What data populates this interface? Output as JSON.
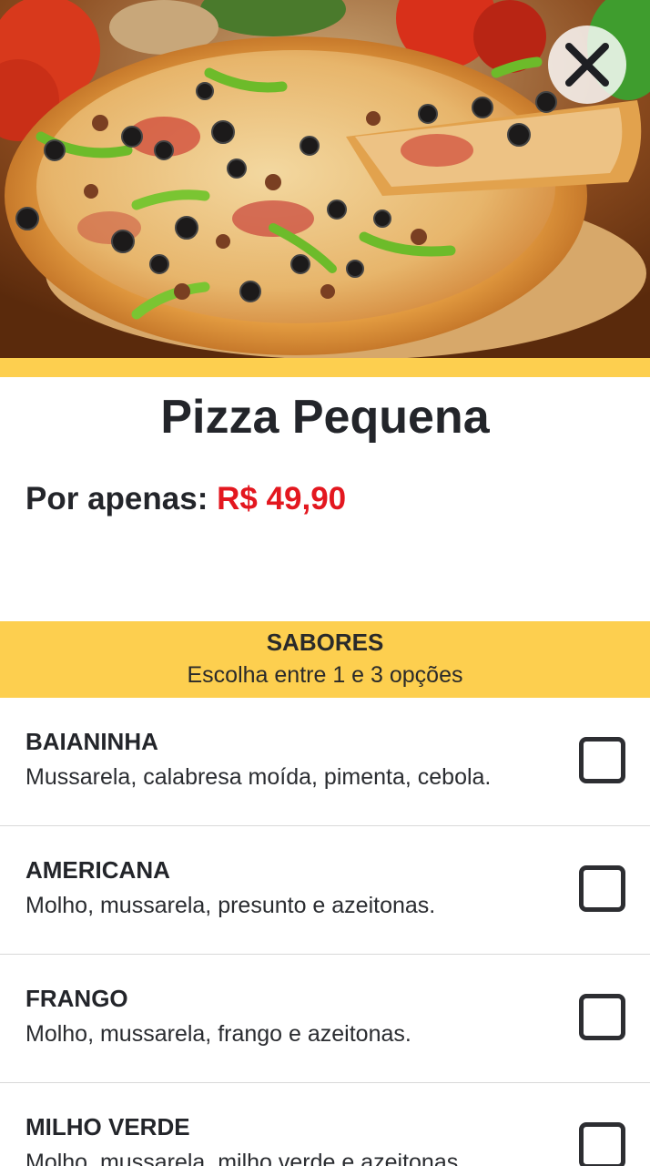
{
  "hero": {
    "image_subject": "pizza-photo",
    "close_icon": "close-icon"
  },
  "product": {
    "title": "Pizza Pequena",
    "price_label": "Por apenas: ",
    "price_value": "R$ 49,90"
  },
  "flavors_section": {
    "title": "SABORES",
    "subtitle": "Escolha entre 1 e 3 opções"
  },
  "flavors": [
    {
      "name": "BAIANINHA",
      "description": "Mussarela, calabresa moída, pimenta, cebola.",
      "checked": false
    },
    {
      "name": "AMERICANA",
      "description": "Molho, mussarela, presunto e azeitonas.",
      "checked": false
    },
    {
      "name": "FRANGO",
      "description": "Molho, mussarela, frango e azeitonas.",
      "checked": false
    },
    {
      "name": "MILHO VERDE",
      "description": "Molho, mussarela, milho verde e azeitonas.",
      "checked": false
    }
  ],
  "colors": {
    "accent": "#fdcf4f",
    "price": "#e3171f",
    "text": "#23252a",
    "divider": "#d9d9d9"
  }
}
